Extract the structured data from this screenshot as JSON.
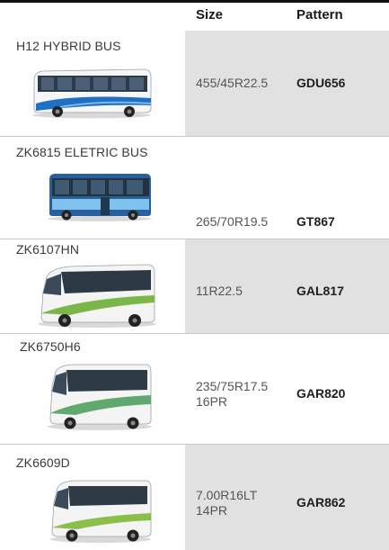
{
  "header": {
    "size_label": "Size",
    "pattern_label": "Pattern"
  },
  "rows": [
    {
      "model": "H12 HYBRID BUS",
      "size": "455/45R22.5",
      "pattern": "GDU656",
      "bus_icon": "hybrid-city-bus-icon"
    },
    {
      "model": "ZK6815 ELETRIC BUS",
      "size": "265/70R19.5",
      "pattern": "GT867",
      "bus_icon": "electric-city-bus-icon"
    },
    {
      "model": "ZK6107HN",
      "size": "11R22.5",
      "pattern": "GAL817",
      "bus_icon": "coach-bus-icon"
    },
    {
      "model": "ZK6750H6",
      "size": "235/75R17.5 16PR",
      "pattern": "GAR820",
      "bus_icon": "coach-bus-icon"
    },
    {
      "model": "ZK6609D",
      "size": "7.00R16LT 14PR",
      "pattern": "GAR862",
      "bus_icon": "minibus-coach-icon"
    }
  ],
  "colors": {
    "row_shade": "#e1e1e1",
    "divider": "#c7c7c7",
    "accent_blue": "#1f6fc4"
  }
}
